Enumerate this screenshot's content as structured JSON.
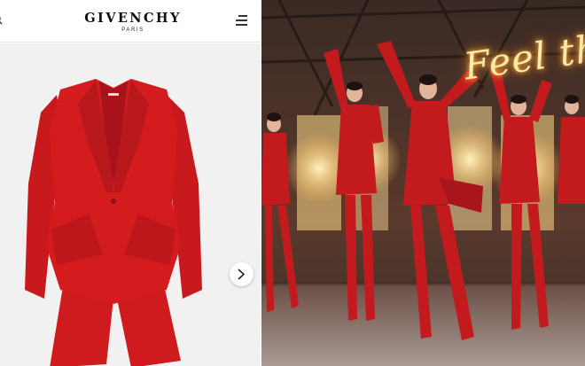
{
  "header": {
    "brand": "GIVENCHY",
    "brand_sub": "PARIS"
  },
  "icons": {
    "search": "search-icon",
    "menu": "hamburger-menu-icon",
    "next": "chevron-right-icon"
  },
  "colors": {
    "jacket_red": "#d41c1e",
    "background_grey": "#f1f1f1",
    "stage_dark": "#2c201c",
    "neon": "#ffe9a8"
  },
  "stage": {
    "neon_sign": "Feel th"
  }
}
